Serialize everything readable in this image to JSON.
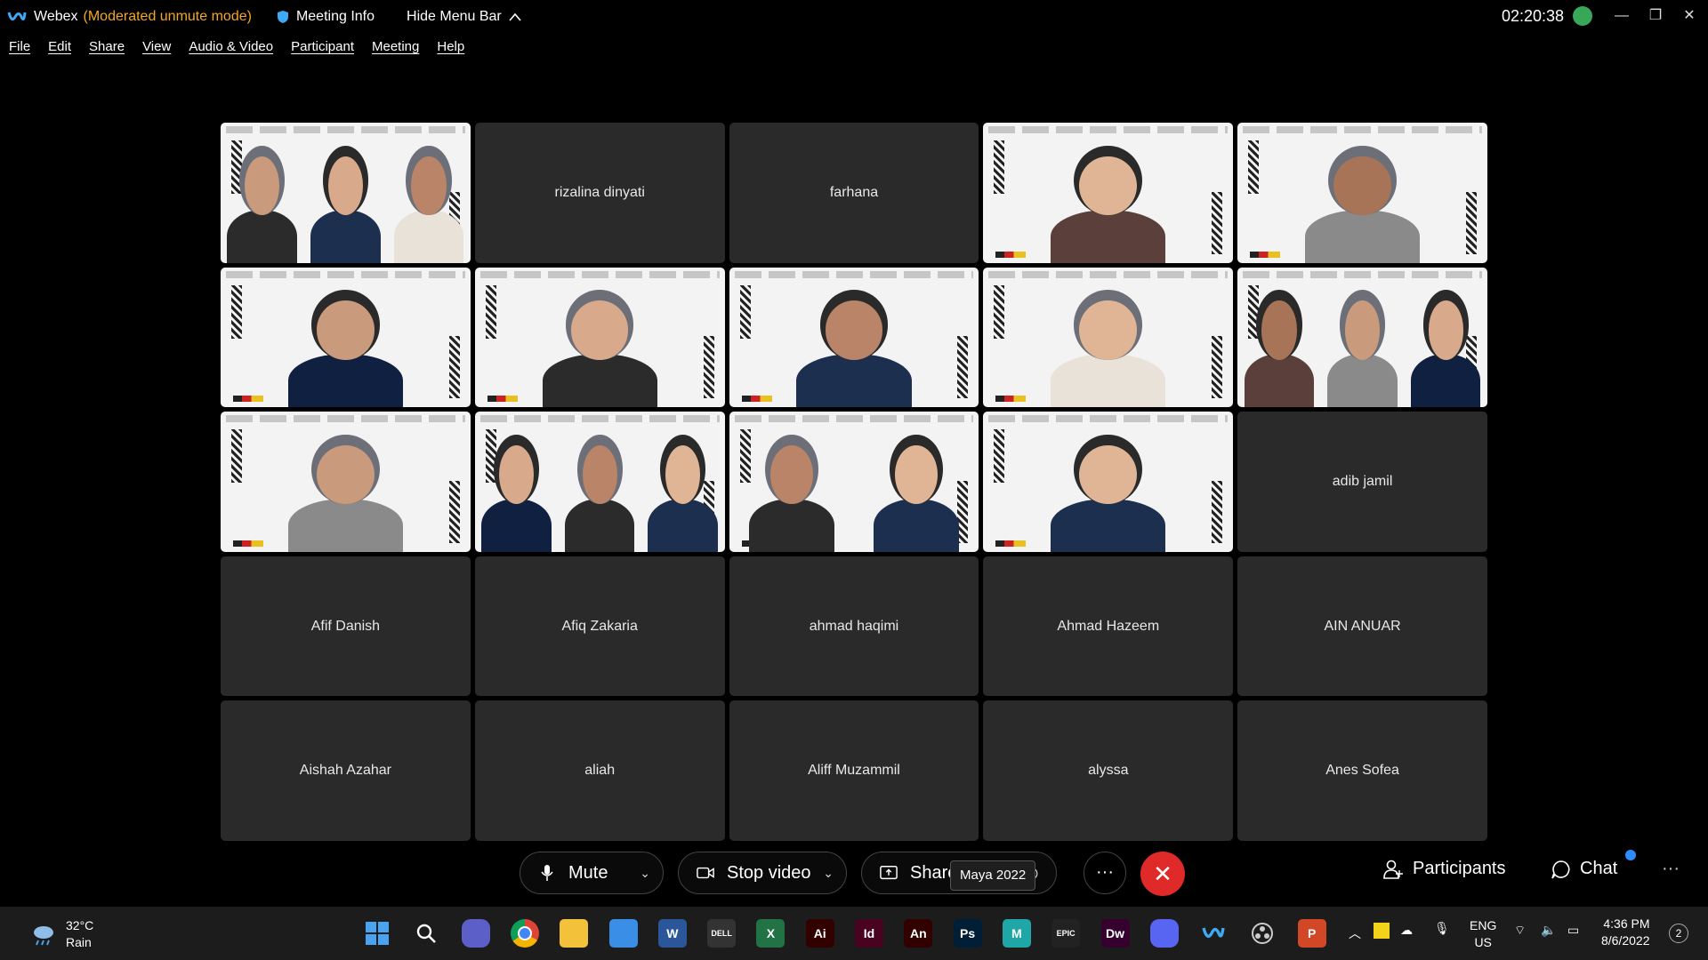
{
  "titlebar": {
    "app_name": "Webex",
    "mode": "(Moderated unmute mode)",
    "meeting_info": "Meeting Info",
    "hide_menu": "Hide Menu Bar",
    "timer": "02:20:38"
  },
  "menu": [
    "File",
    "Edit",
    "Share",
    "View",
    "Audio & Video",
    "Participant",
    "Meeting",
    "Help"
  ],
  "tiles": [
    {
      "type": "video"
    },
    {
      "type": "name",
      "name": "rizalina dinyati"
    },
    {
      "type": "name",
      "name": "farhana"
    },
    {
      "type": "video"
    },
    {
      "type": "video"
    },
    {
      "type": "video"
    },
    {
      "type": "video"
    },
    {
      "type": "video"
    },
    {
      "type": "video"
    },
    {
      "type": "video"
    },
    {
      "type": "video"
    },
    {
      "type": "video"
    },
    {
      "type": "video"
    },
    {
      "type": "video"
    },
    {
      "type": "name",
      "name": "adib jamil"
    },
    {
      "type": "name",
      "name": "Afif Danish"
    },
    {
      "type": "name",
      "name": "Afiq Zakaria"
    },
    {
      "type": "name",
      "name": "ahmad haqimi"
    },
    {
      "type": "name",
      "name": "Ahmad Hazeem"
    },
    {
      "type": "name",
      "name": "AIN ANUAR"
    },
    {
      "type": "name",
      "name": "Aishah Azahar"
    },
    {
      "type": "name",
      "name": "aliah"
    },
    {
      "type": "name",
      "name": "Aliff Muzammil"
    },
    {
      "type": "name",
      "name": "alyssa"
    },
    {
      "type": "name",
      "name": "Anes Sofea"
    }
  ],
  "controls": {
    "mute": "Mute",
    "stop_video": "Stop video",
    "share": "Share",
    "tooltip": "Maya 2022",
    "participants": "Participants",
    "chat": "Chat",
    "more": "···",
    "overflow": "···"
  },
  "taskbar": {
    "temp": "32°C",
    "weather": "Rain",
    "lang1": "ENG",
    "lang2": "US",
    "time": "4:36 PM",
    "date": "8/6/2022",
    "notifications": "2",
    "icons": [
      {
        "name": "start-icon",
        "label": "",
        "color": "#4aa3f0"
      },
      {
        "name": "search-icon",
        "label": "",
        "color": "#1c1c1c"
      },
      {
        "name": "teams-chat-icon",
        "label": "",
        "color": "#5b5fc7"
      },
      {
        "name": "chrome-icon",
        "label": "",
        "color": "#db4437"
      },
      {
        "name": "file-explorer-icon",
        "label": "",
        "color": "#f3c13a"
      },
      {
        "name": "mail-icon",
        "label": "",
        "color": "#3a8ee6"
      },
      {
        "name": "word-icon",
        "label": "W",
        "color": "#2b579a"
      },
      {
        "name": "dell-icon",
        "label": "DELL",
        "color": "#333"
      },
      {
        "name": "excel-icon",
        "label": "X",
        "color": "#217346"
      },
      {
        "name": "illustrator-icon",
        "label": "Ai",
        "color": "#330000"
      },
      {
        "name": "indesign-icon",
        "label": "Id",
        "color": "#49021f"
      },
      {
        "name": "animate-icon",
        "label": "An",
        "color": "#330000"
      },
      {
        "name": "photoshop-icon",
        "label": "Ps",
        "color": "#001e36"
      },
      {
        "name": "maya-icon",
        "label": "M",
        "color": "#1fa6a6"
      },
      {
        "name": "epic-games-icon",
        "label": "EPIC",
        "color": "#222"
      },
      {
        "name": "dreamweaver-icon",
        "label": "Dw",
        "color": "#35002e"
      },
      {
        "name": "discord-icon",
        "label": "",
        "color": "#5865f2"
      },
      {
        "name": "webex-icon",
        "label": "",
        "color": "#1c1c1c"
      },
      {
        "name": "obs-icon",
        "label": "",
        "color": "#1c1c1c"
      },
      {
        "name": "powerpoint-icon",
        "label": "P",
        "color": "#d24726"
      }
    ]
  }
}
